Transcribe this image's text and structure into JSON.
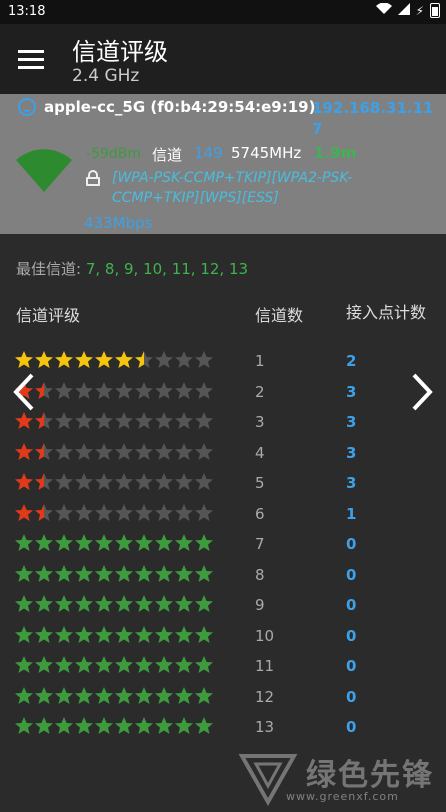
{
  "status": {
    "time": "13:18"
  },
  "appbar": {
    "title": "信道评级",
    "subtitle": "2.4 GHz"
  },
  "network": {
    "ssid": "apple-cc_5G (f0:b4:29:54:e9:19)",
    "ip": "192.168.31.117",
    "signal": "-59dBm",
    "channel_label": "信道",
    "channel": "149",
    "frequency": "5745MHz",
    "distance": "1.9m",
    "capabilities": "[WPA-PSK-CCMP+TKIP][WPA2-PSK-CCMP+TKIP][WPS][ESS]",
    "speed": "433Mbps"
  },
  "best": {
    "label": "最佳信道:",
    "value": "7, 8, 9, 10, 11, 12, 13"
  },
  "headers": {
    "rating": "信道评级",
    "channel_count": "信道数",
    "ap_count": "接入点计数"
  },
  "colors": {
    "gold": "#f5c40f",
    "red": "#e03a1b",
    "green": "#3d9a3d",
    "empty": "#555555",
    "blue": "#3da0e8"
  },
  "rows": [
    {
      "channel": "1",
      "ap_count": "2",
      "rating": 6.5,
      "color": "gold"
    },
    {
      "channel": "2",
      "ap_count": "3",
      "rating": 1.5,
      "color": "red"
    },
    {
      "channel": "3",
      "ap_count": "3",
      "rating": 1.5,
      "color": "red"
    },
    {
      "channel": "4",
      "ap_count": "3",
      "rating": 1.5,
      "color": "red"
    },
    {
      "channel": "5",
      "ap_count": "3",
      "rating": 1.5,
      "color": "red"
    },
    {
      "channel": "6",
      "ap_count": "1",
      "rating": 1.5,
      "color": "red"
    },
    {
      "channel": "7",
      "ap_count": "0",
      "rating": 10,
      "color": "green"
    },
    {
      "channel": "8",
      "ap_count": "0",
      "rating": 10,
      "color": "green"
    },
    {
      "channel": "9",
      "ap_count": "0",
      "rating": 10,
      "color": "green"
    },
    {
      "channel": "10",
      "ap_count": "0",
      "rating": 10,
      "color": "green"
    },
    {
      "channel": "11",
      "ap_count": "0",
      "rating": 10,
      "color": "green"
    },
    {
      "channel": "12",
      "ap_count": "0",
      "rating": 10,
      "color": "green"
    },
    {
      "channel": "13",
      "ap_count": "0",
      "rating": 10,
      "color": "green"
    }
  ],
  "max_stars": 10,
  "watermark": {
    "text": "绿色先锋",
    "url": "www.greenxf.com"
  }
}
